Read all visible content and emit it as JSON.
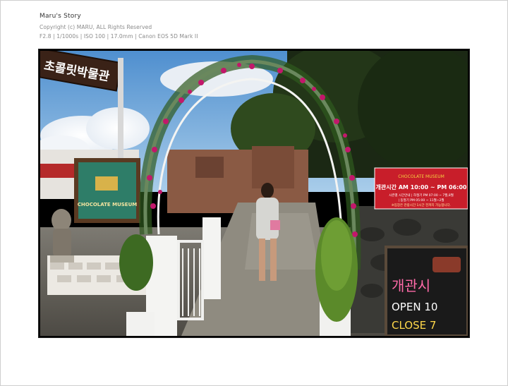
{
  "header": {
    "title": "Maru's Story",
    "copyright": "Copyright (c) MARU, ALL Rights Reserved",
    "exif": "F2.8 | 1/1000s | ISO 100 | 17.0mm | Canon EOS 5D Mark II"
  },
  "photo": {
    "korean_sign": "초콜릿박물관",
    "wall_sign": "CHOCOLATE MUSEUM",
    "hours_sign": {
      "brand": "CHOCOLATE MUSEUM",
      "hours": "개관시간  AM 10:00 ~ PM 06:00",
      "line1": "시즌별 시간안내 | 하절기 PM 07:00 ~ 7월,8월",
      "line2": "| 동절기 PM 05:00 ~ 11월~2월",
      "note": "※입장은 관람시간 1시간 전까지 가능합니다."
    },
    "chalkboard": {
      "line1": "개관시",
      "line2": "OPEN 10",
      "line3": "CLOSE 7"
    }
  },
  "colors": {
    "sky": "#6aa6da",
    "foliage": "#2f4a1e",
    "rose": "#c2186b",
    "sign_red": "#c81e2a"
  }
}
